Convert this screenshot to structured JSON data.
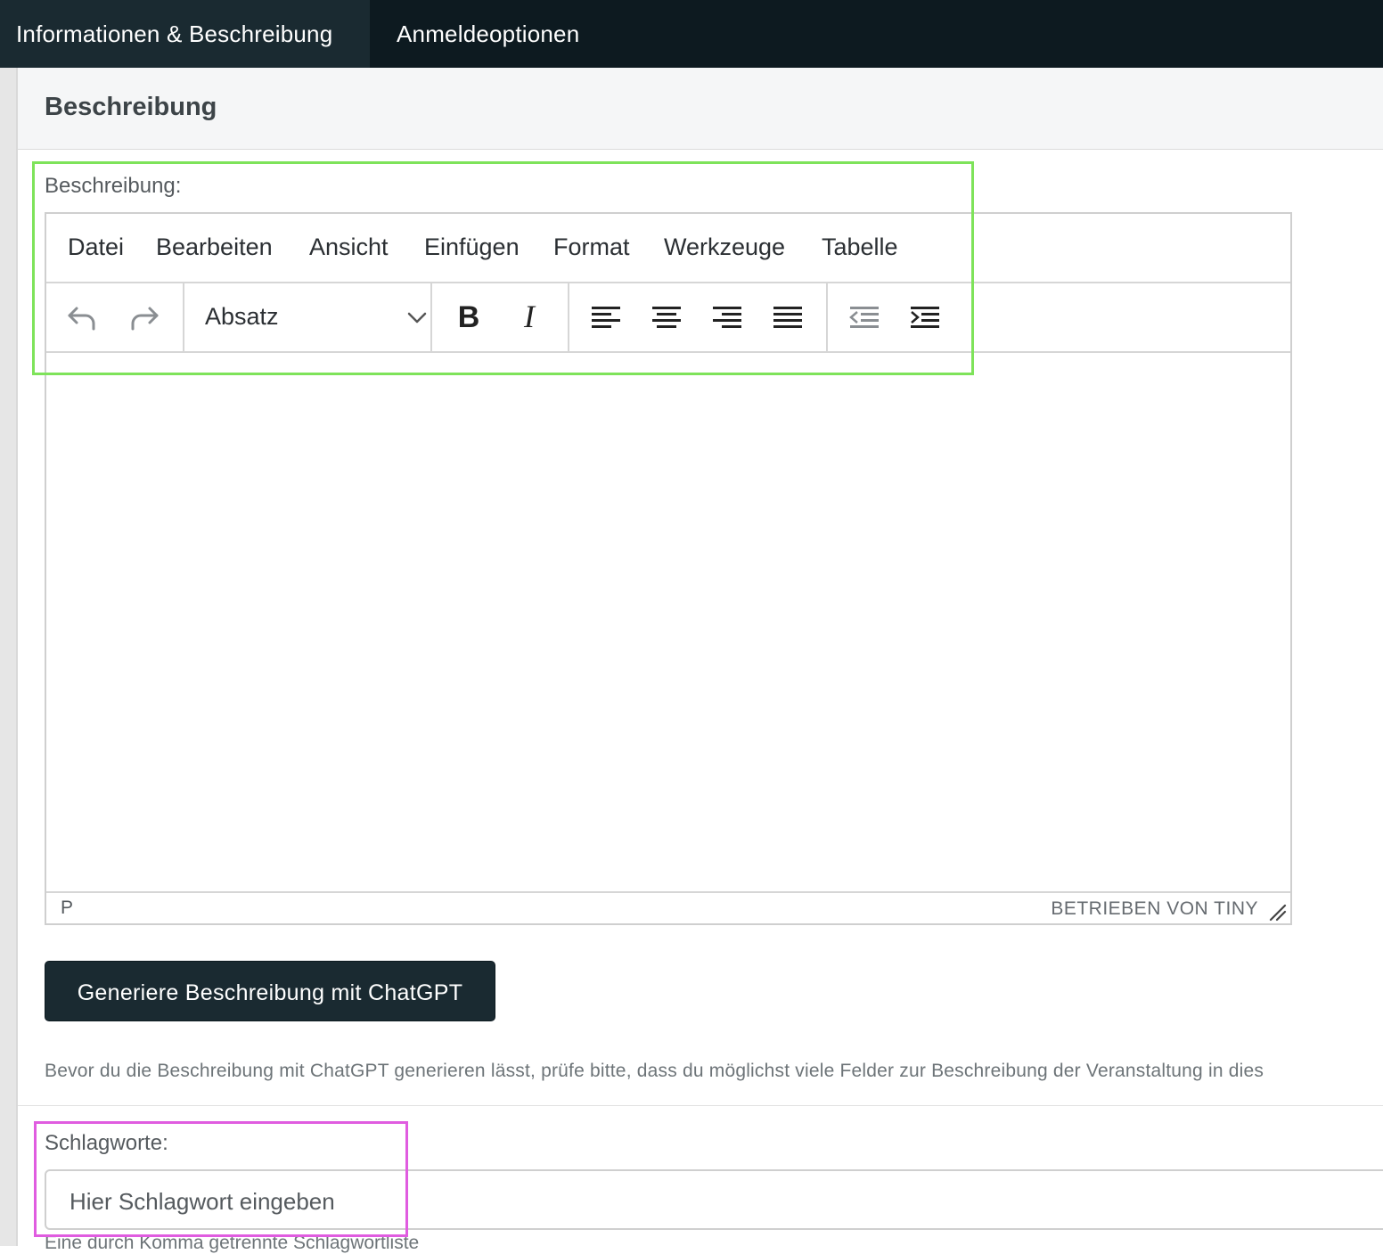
{
  "tabs": [
    {
      "label": "Informationen & Beschreibung",
      "active": true
    },
    {
      "label": "Anmeldeoptionen",
      "active": false
    }
  ],
  "section": {
    "title": "Beschreibung"
  },
  "description": {
    "label": "Beschreibung:",
    "menu": [
      "Datei",
      "Bearbeiten",
      "Ansicht",
      "Einfügen",
      "Format",
      "Werkzeuge",
      "Tabelle"
    ],
    "block_format": "Absatz",
    "status_path": "P",
    "status_brand": "BETRIEBEN VON TINY",
    "toolbar_icons": [
      "undo-icon",
      "redo-icon",
      "bold-icon",
      "italic-icon",
      "align-left-icon",
      "align-center-icon",
      "align-right-icon",
      "align-justify-icon",
      "outdent-icon",
      "indent-icon"
    ]
  },
  "generate_button": {
    "label": "Generiere Beschreibung mit ChatGPT"
  },
  "help_text": "Bevor du die Beschreibung mit ChatGPT generieren lässt, prüfe bitte, dass du möglichst viele Felder zur Beschreibung der Veranstaltung in dies",
  "keywords": {
    "label": "Schlagworte:",
    "placeholder": "Hier Schlagwort eingeben",
    "hint": "Eine durch Komma getrennte Schlagwortliste"
  },
  "colors": {
    "nav_bg": "#0d1a20",
    "nav_active_bg": "#1a2a31",
    "button_bg": "#1a2a31",
    "highlight_green": "#7ee35a",
    "highlight_magenta": "#e05ce0"
  }
}
